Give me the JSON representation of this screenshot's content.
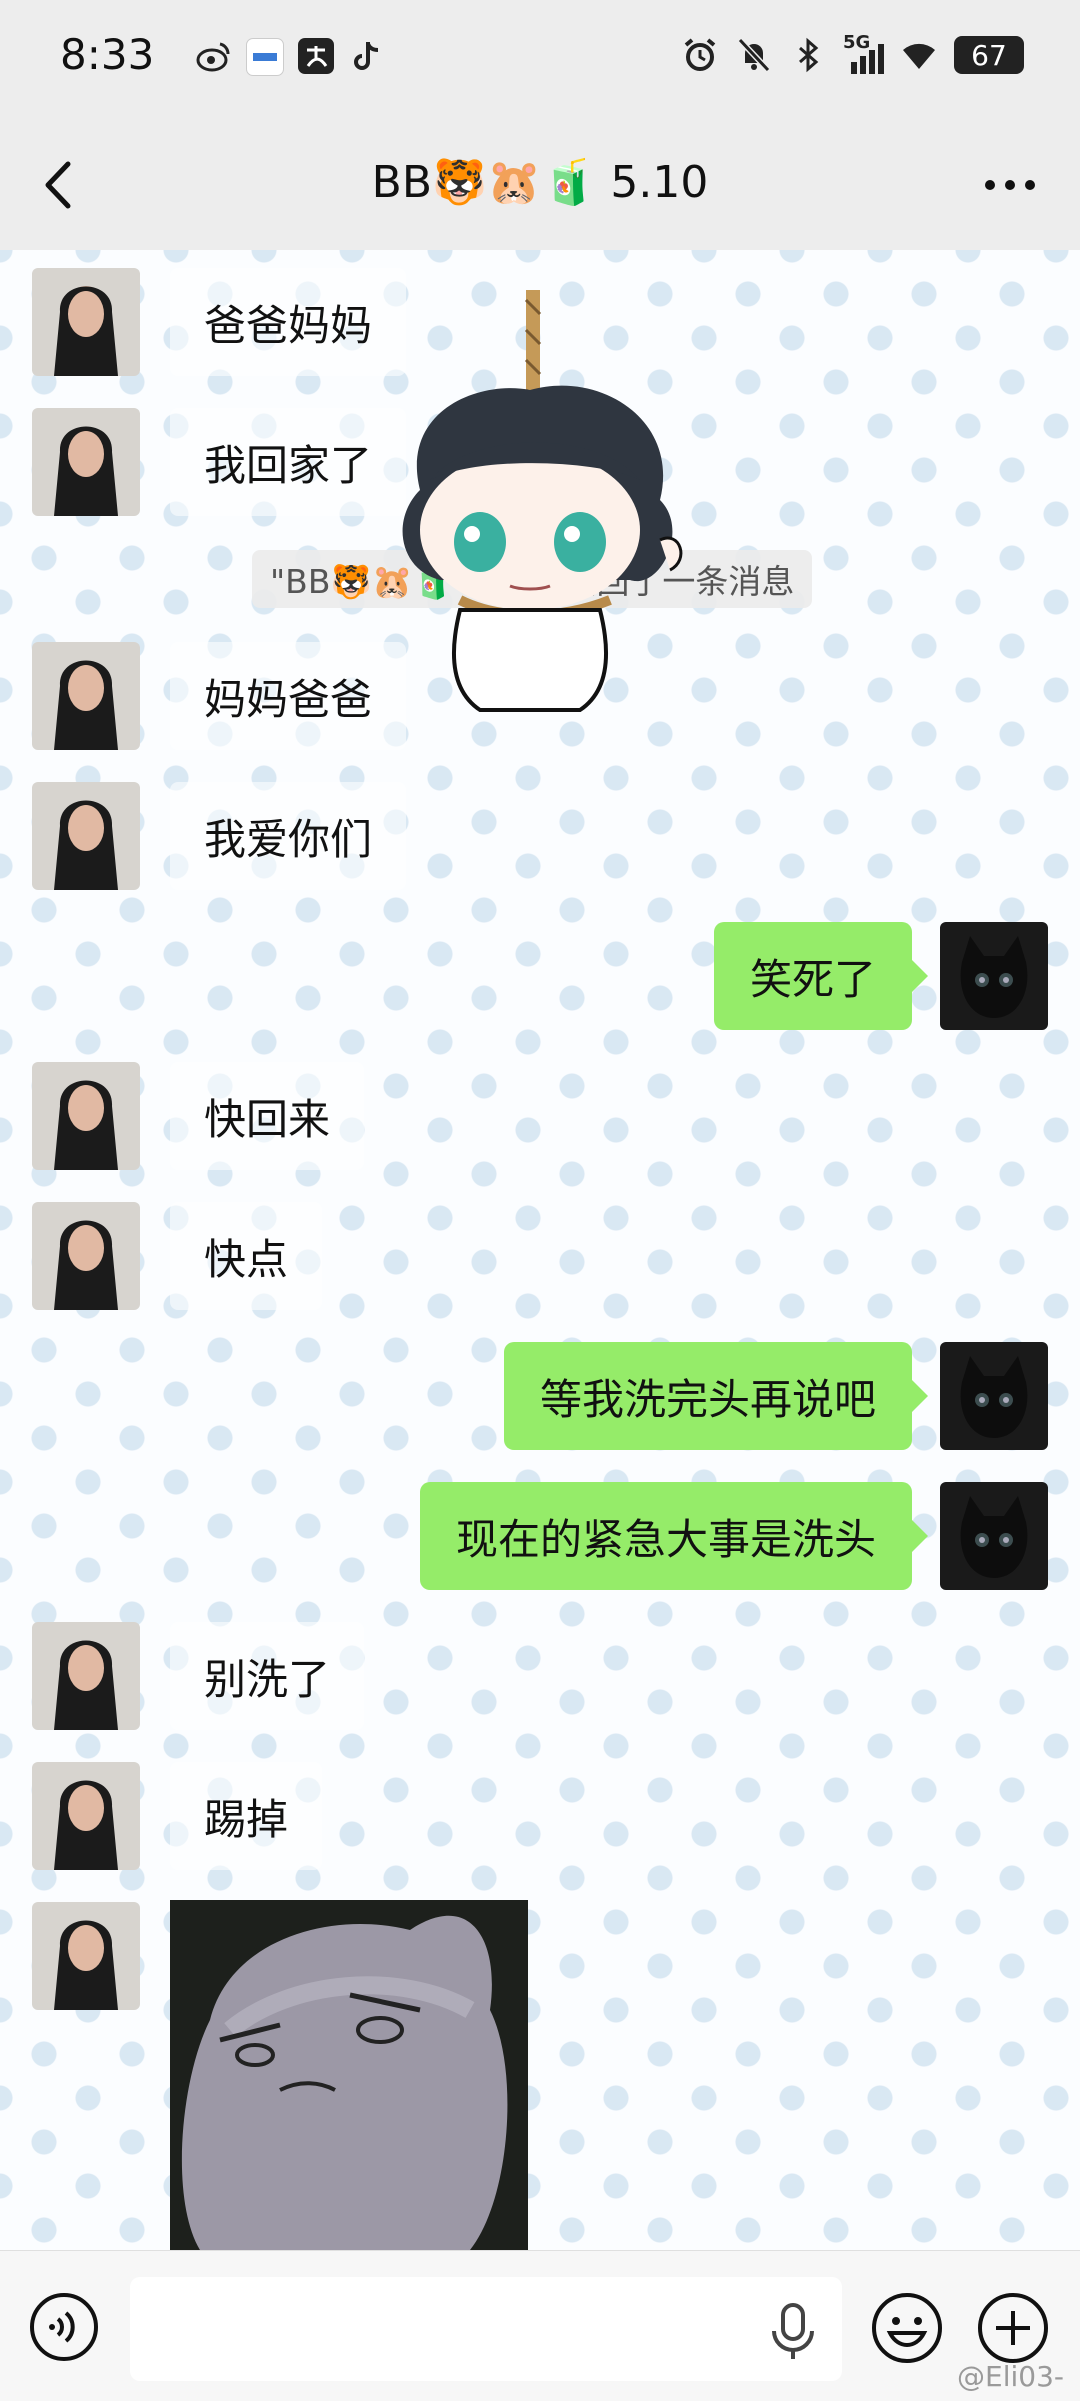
{
  "status_bar": {
    "time": "8:33",
    "network": "5G",
    "battery": "67",
    "left_icons": [
      "weibo-icon",
      "xiaohongshu-icon",
      "alipay-icon",
      "tiktok-icon"
    ],
    "right_icons": [
      "alarm-icon",
      "mute-bell-icon",
      "bluetooth-icon",
      "signal-icon",
      "wifi-icon",
      "battery-icon"
    ]
  },
  "header": {
    "title": "BB🐯🐹🧃 5.10",
    "back_icon": "chevron-left-icon",
    "more_icon": "ellipsis-icon"
  },
  "messages": [
    {
      "side": "left",
      "text": "爸爸妈妈"
    },
    {
      "side": "left",
      "text": "我回家了"
    },
    {
      "side": "system",
      "text": "\"BB🐯🐹🧃 5.10\" 撤回了一条消息"
    },
    {
      "side": "left",
      "text": "妈妈爸爸"
    },
    {
      "side": "left",
      "text": "我爱你们"
    },
    {
      "side": "right",
      "text": "笑死了"
    },
    {
      "side": "left",
      "text": "快回来"
    },
    {
      "side": "left",
      "text": "快点"
    },
    {
      "side": "right",
      "text": "等我洗完头再说吧"
    },
    {
      "side": "right",
      "text": "现在的紧急大事是洗头"
    },
    {
      "side": "left",
      "text": "别洗了"
    },
    {
      "side": "left",
      "text": "踢掉"
    },
    {
      "side": "left",
      "type": "image"
    }
  ],
  "input_bar": {
    "value": "",
    "voice_icon": "voice-icon",
    "mic_icon": "microphone-icon",
    "emoji_icon": "emoji-icon",
    "plus_icon": "plus-icon"
  },
  "watermark": "@Eli03-",
  "colors": {
    "bubble_green": "#95ec69",
    "header_bg": "#ededed"
  }
}
